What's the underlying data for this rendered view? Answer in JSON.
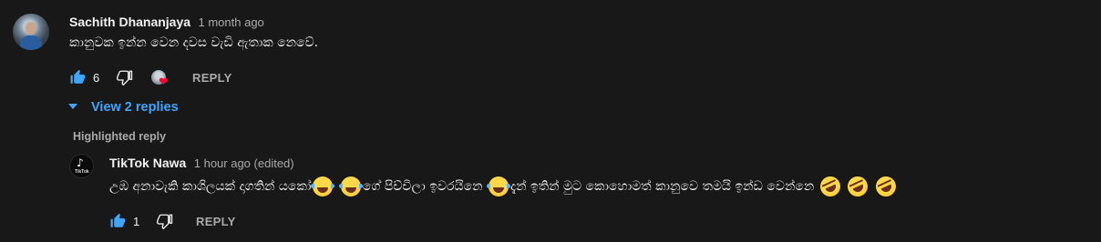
{
  "comment": {
    "author": "Sachith Dhananjaya",
    "time": "1 month ago",
    "text": "කානුවක ඉන්න වෙන දවස වැඩි ඇතාක නෙවේ.",
    "like_count": "6",
    "reply_label": "REPLY",
    "heart_color": "#ff0033"
  },
  "view_replies": {
    "label": "View 2 replies",
    "color": "#3ea6ff"
  },
  "highlighted_label": "Highlighted reply",
  "reply": {
    "author": "TikTok Nawa",
    "time": "1 hour ago (edited)",
    "avatar_label": "TikTok",
    "text_part1": "උඹ අනාවැකි කාශිලයක් දාගතින් යකෝ",
    "text_part2": "ගේ පිච්චිලා ඉවරයිනෙ",
    "text_part3": "දැන් ඉතින් මුට කොහොමත් කානුවෙ තමයි ඉන්ඩ වෙන්නෙ",
    "like_count": "1",
    "reply_label": "REPLY"
  },
  "icons": {
    "like": "thumbs-up-icon",
    "dislike": "thumbs-down-icon",
    "expand": "caret-down-icon",
    "emoji_joy": "face-with-tears-of-joy-emoji",
    "emoji_rofl": "rolling-on-floor-laughing-emoji",
    "tiktok": "tiktok-logo-icon"
  },
  "accent_color": "#3ea6ff",
  "background_color": "#181818"
}
